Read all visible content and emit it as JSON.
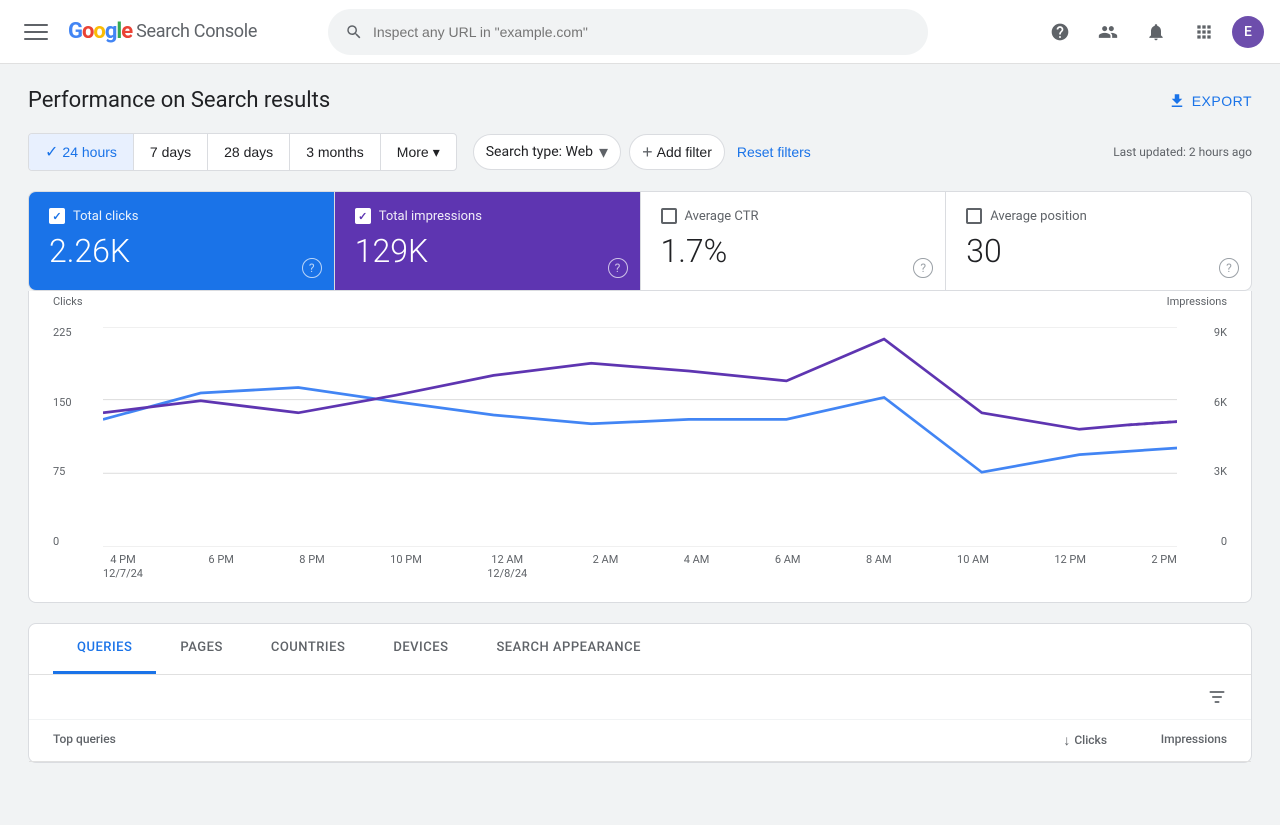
{
  "app": {
    "name": "Google Search Console",
    "logo": {
      "colors": [
        "#4285f4",
        "#ea4335",
        "#fbbc05",
        "#34a853"
      ],
      "text": "Search Console"
    }
  },
  "nav": {
    "search_placeholder": "Inspect any URL in \"example.com\"",
    "avatar_initial": "E",
    "export_label": "EXPORT"
  },
  "page": {
    "title": "Performance on Search results"
  },
  "filters": {
    "time_options": [
      {
        "label": "24 hours",
        "active": true
      },
      {
        "label": "7 days",
        "active": false
      },
      {
        "label": "28 days",
        "active": false
      },
      {
        "label": "3 months",
        "active": false
      },
      {
        "label": "More",
        "active": false
      }
    ],
    "search_type_label": "Search type: Web",
    "add_filter_label": "Add filter",
    "reset_label": "Reset filters",
    "last_updated": "Last updated: 2 hours ago"
  },
  "metrics": [
    {
      "id": "total-clicks",
      "label": "Total clicks",
      "value": "2.26K",
      "checked": true,
      "theme": "blue"
    },
    {
      "id": "total-impressions",
      "label": "Total impressions",
      "value": "129K",
      "checked": true,
      "theme": "purple"
    },
    {
      "id": "average-ctr",
      "label": "Average CTR",
      "value": "1.7%",
      "checked": false,
      "theme": "none"
    },
    {
      "id": "average-position",
      "label": "Average position",
      "value": "30",
      "checked": false,
      "theme": "none"
    }
  ],
  "chart": {
    "y_left_axis_title": "Clicks",
    "y_right_axis_title": "Impressions",
    "y_left_labels": [
      "225",
      "150",
      "75",
      "0"
    ],
    "y_right_labels": [
      "9K",
      "6K",
      "3K",
      "0"
    ],
    "x_labels": [
      {
        "line1": "4 PM",
        "line2": "12/7/24"
      },
      {
        "line1": "6 PM",
        "line2": ""
      },
      {
        "line1": "8 PM",
        "line2": ""
      },
      {
        "line1": "10 PM",
        "line2": ""
      },
      {
        "line1": "12 AM",
        "line2": "12/8/24"
      },
      {
        "line1": "2 AM",
        "line2": ""
      },
      {
        "line1": "4 AM",
        "line2": ""
      },
      {
        "line1": "6 AM",
        "line2": ""
      },
      {
        "line1": "8 AM",
        "line2": ""
      },
      {
        "line1": "10 AM",
        "line2": ""
      },
      {
        "line1": "12 PM",
        "line2": ""
      },
      {
        "line1": "2 PM",
        "line2": ""
      }
    ],
    "clicks_color": "#4285f4",
    "impressions_color": "#5e35b1"
  },
  "tabs": [
    {
      "label": "QUERIES",
      "active": true
    },
    {
      "label": "PAGES",
      "active": false
    },
    {
      "label": "COUNTRIES",
      "active": false
    },
    {
      "label": "DEVICES",
      "active": false
    },
    {
      "label": "SEARCH APPEARANCE",
      "active": false
    }
  ],
  "table": {
    "col_queries": "Top queries",
    "col_clicks": "Clicks",
    "col_impressions": "Impressions"
  }
}
